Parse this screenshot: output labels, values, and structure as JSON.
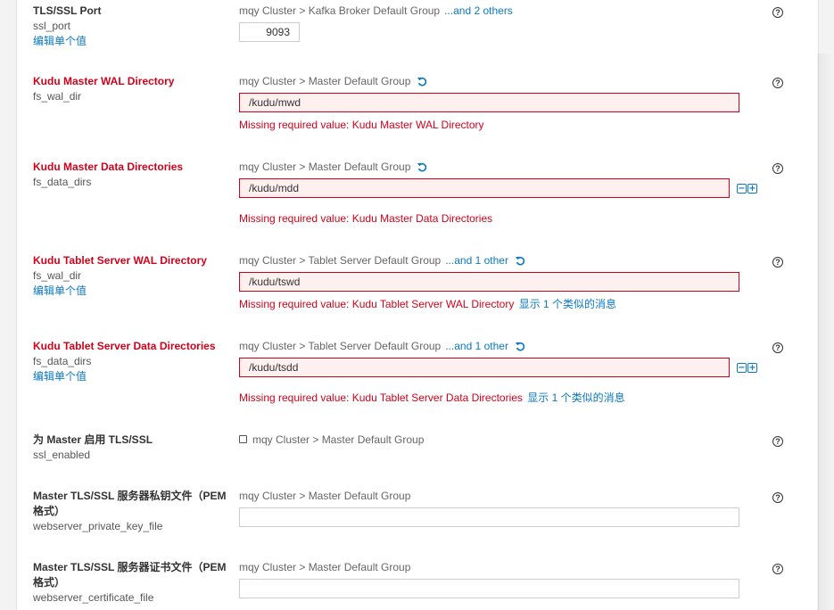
{
  "settings": [
    {
      "title": "TLS/SSL Port",
      "key": "ssl_port",
      "edit_link": "编辑单个值",
      "scope": "mqy Cluster > Kafka Broker Default Group",
      "scope_more": "...and 2 others",
      "value": "9093"
    },
    {
      "title": "Kudu Master WAL Directory",
      "key": "fs_wal_dir",
      "scope": "mqy Cluster > Master Default Group",
      "value": "/kudu/mwd",
      "error": "Missing required value: Kudu Master WAL Directory"
    },
    {
      "title": "Kudu Master Data Directories",
      "key": "fs_data_dirs",
      "scope": "mqy Cluster > Master Default Group",
      "value": "/kudu/mdd",
      "error": "Missing required value: Kudu Master Data Directories"
    },
    {
      "title": "Kudu Tablet Server WAL Directory",
      "key": "fs_wal_dir",
      "edit_link": "编辑单个值",
      "scope": "mqy Cluster > Tablet Server Default Group",
      "scope_more": "...and 1 other",
      "value": "/kudu/tswd",
      "error": "Missing required value: Kudu Tablet Server WAL Directory",
      "error_more": "显示 1 个类似的消息"
    },
    {
      "title": "Kudu Tablet Server Data Directories",
      "key": "fs_data_dirs",
      "edit_link": "编辑单个值",
      "scope": "mqy Cluster > Tablet Server Default Group",
      "scope_more": "...and 1 other",
      "value": "/kudu/tsdd",
      "error": "Missing required value: Kudu Tablet Server Data Directories",
      "error_more": "显示 1 个类似的消息"
    },
    {
      "title": "为 Master 启用 TLS/SSL",
      "key": "ssl_enabled",
      "scope": "mqy Cluster > Master Default Group",
      "checked": false
    },
    {
      "title_line1": "Master TLS/SSL 服务器私钥文件（PEM",
      "title_line2": "格式）",
      "key": "webserver_private_key_file",
      "scope": "mqy Cluster > Master Default Group",
      "value": ""
    },
    {
      "title_line1": "Master TLS/SSL 服务器证书文件（PEM",
      "title_line2": "格式）",
      "key": "webserver_certificate_file",
      "scope": "mqy Cluster > Master Default Group",
      "value": ""
    }
  ],
  "icons": {
    "help": "?",
    "minus": "−",
    "plus": "+",
    "undo": "undo-icon"
  },
  "colors": {
    "error": "#d0021b",
    "link": "#0b78c2",
    "error_field_bg": "#fff0f0"
  }
}
